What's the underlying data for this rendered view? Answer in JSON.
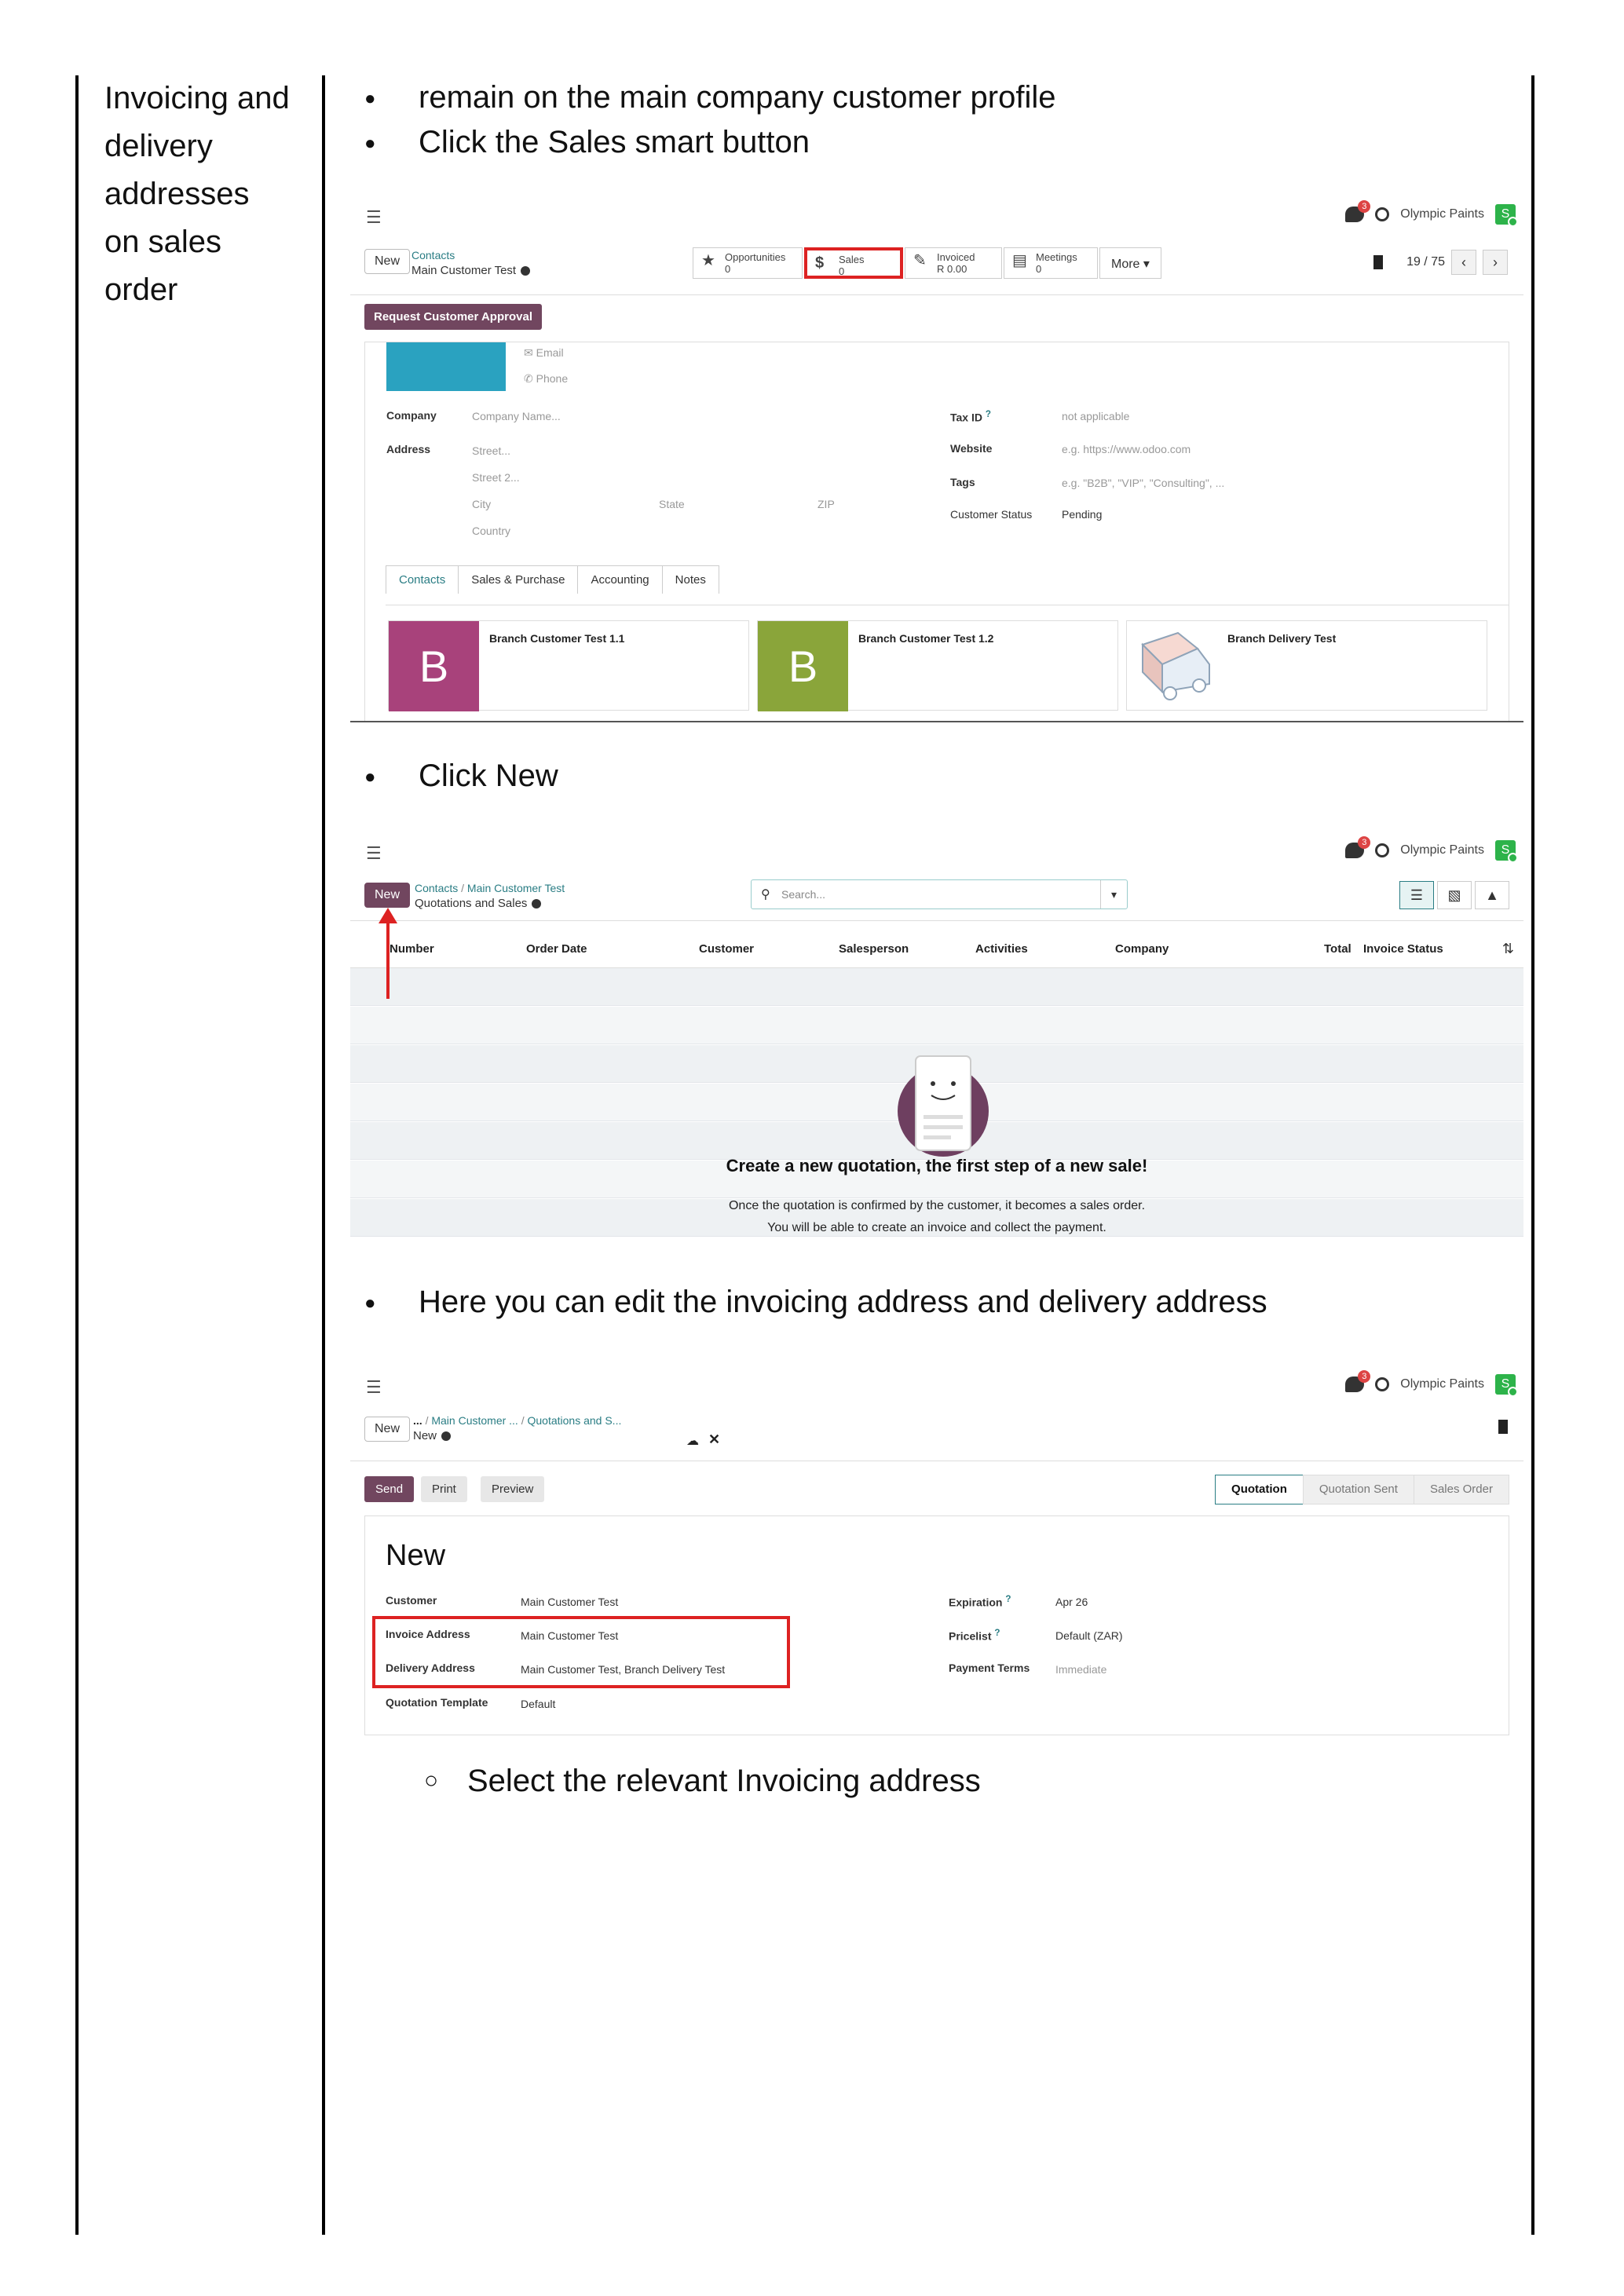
{
  "section": {
    "title_lines": [
      "Invoicing and",
      "delivery",
      "addresses",
      "on sales",
      "order"
    ]
  },
  "steps": {
    "step1": "remain on the main company customer profile",
    "step2": "Click the Sales smart button",
    "step3": "Click New",
    "step4": "Here you can edit the invoicing address and delivery address",
    "step5": "Select the relevant Invoicing address"
  },
  "shot1": {
    "company_name": "Olympic Paints",
    "avatar_letter": "S",
    "chat_count": "3",
    "new_label": "New",
    "crumb_parent": "Contacts",
    "crumb_current": "Main Customer Test",
    "smart_buttons": [
      {
        "label": "Opportunities",
        "value": "0"
      },
      {
        "label": "Sales",
        "value": "0"
      },
      {
        "label": "Invoiced",
        "value": "R 0.00"
      },
      {
        "label": "Meetings",
        "value": "0"
      }
    ],
    "more_label": "More",
    "pager": "19 / 75",
    "approve_label": "Request Customer Approval",
    "email_ph": "Email",
    "phone_ph": "Phone",
    "company_label": "Company",
    "company_ph": "Company Name...",
    "address_label": "Address",
    "street_ph": "Street...",
    "street2_ph": "Street 2...",
    "city_ph": "City",
    "state_ph": "State",
    "zip_ph": "ZIP",
    "country_ph": "Country",
    "taxid_label": "Tax ID",
    "taxid_val": "not applicable",
    "website_label": "Website",
    "website_ph": "e.g. https://www.odoo.com",
    "tags_label": "Tags",
    "tags_ph": "e.g. \"B2B\", \"VIP\", \"Consulting\", ...",
    "status_label": "Customer Status",
    "status_val": "Pending",
    "tabs": [
      "Contacts",
      "Sales & Purchase",
      "Accounting",
      "Notes"
    ],
    "contacts": [
      {
        "letter": "B",
        "name": "Branch Customer Test 1.1",
        "color": "#a8427b"
      },
      {
        "letter": "B",
        "name": "Branch Customer Test 1.2",
        "color": "#8aa53a"
      },
      {
        "letter": "",
        "name": "Branch Delivery Test",
        "color": ""
      }
    ]
  },
  "shot2": {
    "new_label": "New",
    "crumb_1": "Contacts",
    "crumb_2": "Main Customer Test",
    "crumb_current": "Quotations and Sales",
    "search_ph": "Search...",
    "columns": [
      "Number",
      "Order Date",
      "Customer",
      "Salesperson",
      "Activities",
      "Company",
      "Total",
      "Invoice Status"
    ],
    "empty_title": "Create a new quotation, the first step of a new sale!",
    "empty_line1": "Once the quotation is confirmed by the customer, it becomes a sales order.",
    "empty_line2": "You will be able to create an invoice and collect the payment."
  },
  "shot3": {
    "new_label": "New",
    "crumb_dots": "...",
    "crumb_1": "Main Customer ...",
    "crumb_2": "Quotations and S...",
    "crumb_current": "New",
    "btn_send": "Send",
    "btn_print": "Print",
    "btn_preview": "Preview",
    "stages": [
      "Quotation",
      "Quotation Sent",
      "Sales Order"
    ],
    "title": "New",
    "customer_label": "Customer",
    "customer_val": "Main Customer Test",
    "invoice_label": "Invoice Address",
    "invoice_val": "Main Customer Test",
    "delivery_label": "Delivery Address",
    "delivery_val": "Main Customer Test, Branch Delivery Test",
    "template_label": "Quotation Template",
    "template_val": "Default",
    "expiration_label": "Expiration",
    "expiration_val": "Apr 26",
    "pricelist_label": "Pricelist",
    "pricelist_val": "Default (ZAR)",
    "terms_label": "Payment Terms",
    "terms_val": "Immediate"
  }
}
